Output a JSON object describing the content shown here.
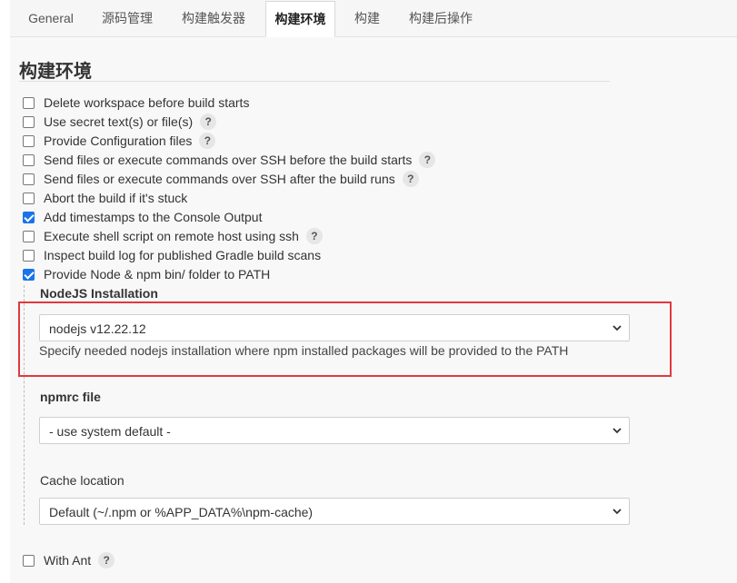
{
  "tabs": [
    {
      "label": "General"
    },
    {
      "label": "源码管理"
    },
    {
      "label": "构建触发器"
    },
    {
      "label": "构建环境"
    },
    {
      "label": "构建"
    },
    {
      "label": "构建后操作"
    }
  ],
  "active_tab": "构建环境",
  "section": {
    "title": "构建环境"
  },
  "help_label": "?",
  "options": [
    {
      "label": "Delete workspace before build starts",
      "checked": false
    },
    {
      "label": "Use secret text(s) or file(s)",
      "checked": false
    },
    {
      "label": "Provide Configuration files",
      "checked": false
    },
    {
      "label": "Send files or execute commands over SSH before the build starts",
      "checked": false
    },
    {
      "label": "Send files or execute commands over SSH after the build runs",
      "checked": false
    },
    {
      "label": "Abort the build if it's stuck",
      "checked": false
    },
    {
      "label": "Add timestamps to the Console Output",
      "checked": true
    },
    {
      "label": "Execute shell script on remote host using ssh",
      "checked": false
    },
    {
      "label": "Inspect build log for published Gradle build scans",
      "checked": false
    },
    {
      "label": "Provide Node & npm bin/ folder to PATH",
      "checked": true
    }
  ],
  "node": {
    "installation_label": "NodeJS Installation",
    "installation_value": "nodejs  v12.22.12",
    "installation_help": "Specify needed nodejs installation where npm installed packages will be provided to the PATH",
    "npmrc_label": "npmrc file",
    "npmrc_value": "- use system default -",
    "cache_label": "Cache location",
    "cache_value": "Default (~/.npm or %APP_DATA%\\npm-cache)"
  },
  "with_ant": {
    "label": "With Ant",
    "checked": false
  },
  "colors": {
    "highlight_border": "#e0393e",
    "checkbox_checked": "#1a73e8"
  }
}
